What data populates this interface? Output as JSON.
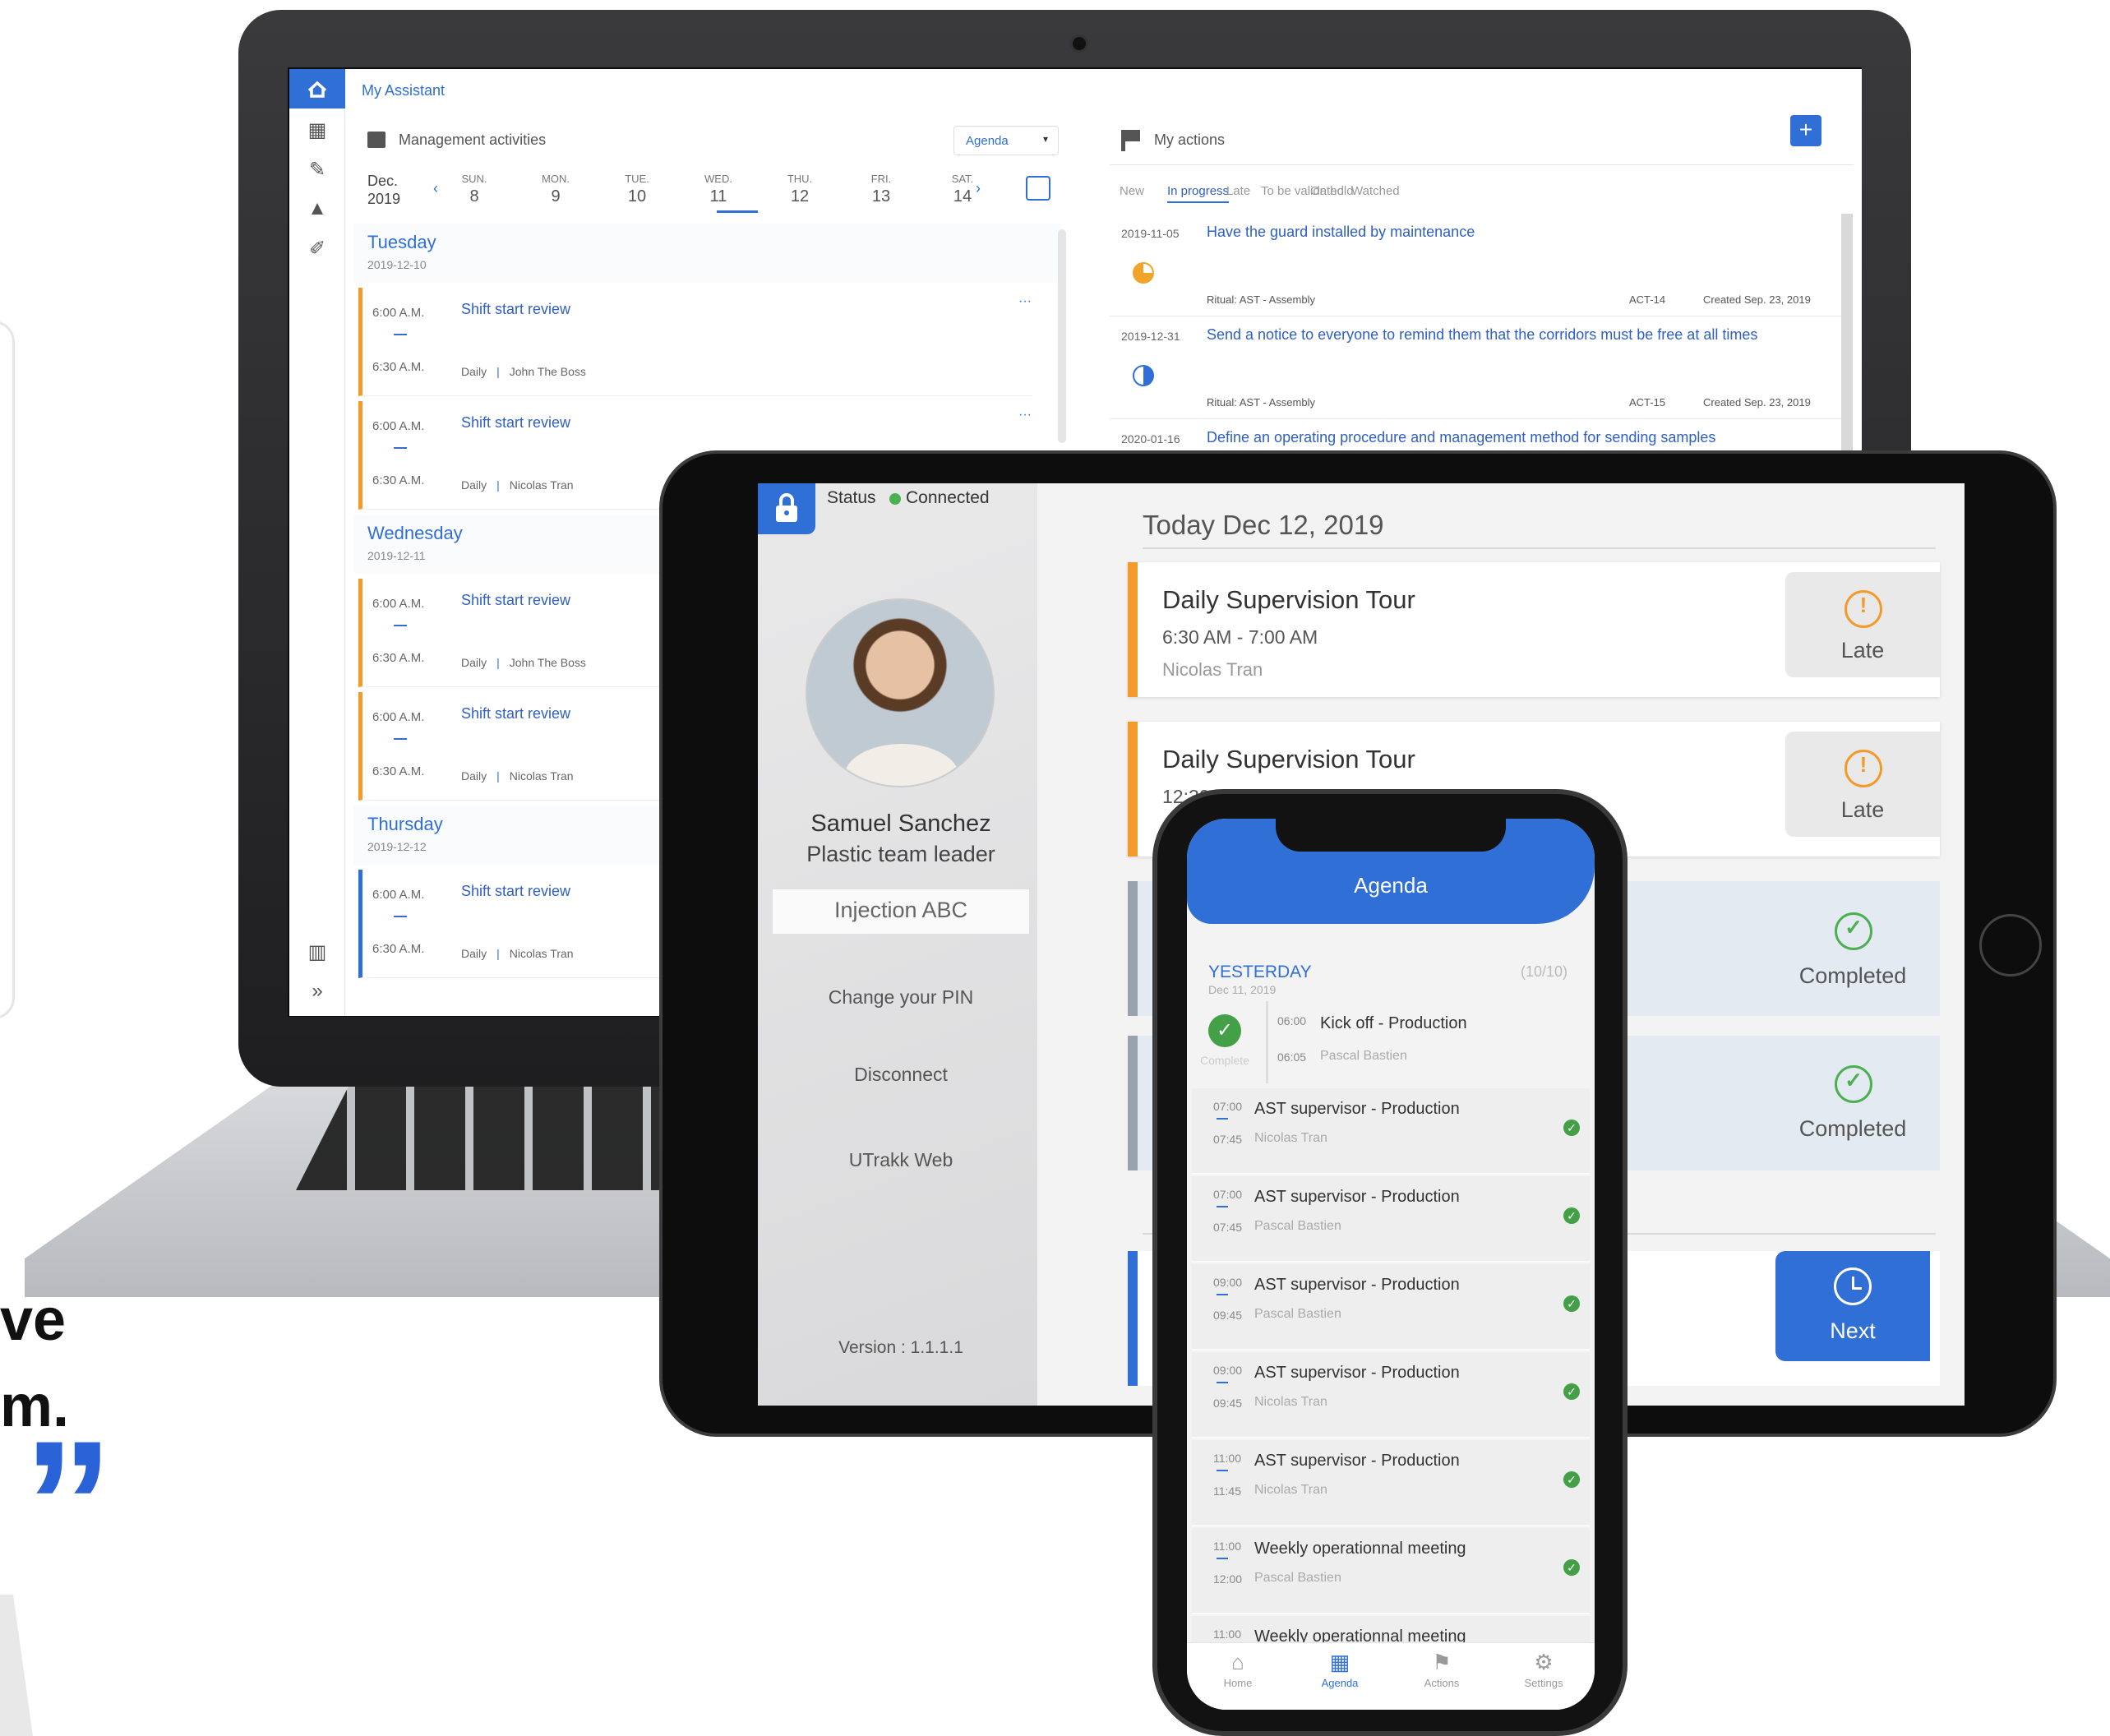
{
  "quote": {
    "line1": "ve",
    "line2": "m.",
    "mark": "”"
  },
  "desktop": {
    "app_title": "My Assistant",
    "management": {
      "title": "Management activities",
      "view_select": "Agenda",
      "month": "Dec.",
      "year": "2019",
      "days": [
        {
          "name": "SUN.",
          "num": "8"
        },
        {
          "name": "MON.",
          "num": "9"
        },
        {
          "name": "TUE.",
          "num": "10"
        },
        {
          "name": "WED.",
          "num": "11"
        },
        {
          "name": "THU.",
          "num": "12"
        },
        {
          "name": "FRI.",
          "num": "13"
        },
        {
          "name": "SAT.",
          "num": "14"
        }
      ],
      "sections": [
        {
          "day": "Tuesday",
          "date": "2019-12-10",
          "items": [
            {
              "start": "6:00 A.M.",
              "end": "6:30 A.M.",
              "title": "Shift start review",
              "freq": "Daily",
              "person": "John The Boss"
            },
            {
              "start": "6:00 A.M.",
              "end": "6:30 A.M.",
              "title": "Shift start review",
              "freq": "Daily",
              "person": "Nicolas Tran"
            }
          ]
        },
        {
          "day": "Wednesday",
          "date": "2019-12-11",
          "items": [
            {
              "start": "6:00 A.M.",
              "end": "6:30 A.M.",
              "title": "Shift start review",
              "freq": "Daily",
              "person": "John The Boss"
            },
            {
              "start": "6:00 A.M.",
              "end": "6:30 A.M.",
              "title": "Shift start review",
              "freq": "Daily",
              "person": "Nicolas Tran"
            }
          ]
        },
        {
          "day": "Thursday",
          "date": "2019-12-12",
          "items": [
            {
              "start": "6:00 A.M.",
              "end": "6:30 A.M.",
              "title": "Shift start review",
              "freq": "Daily",
              "person": "Nicolas Tran"
            }
          ]
        }
      ]
    },
    "actions": {
      "title": "My actions",
      "add": "+",
      "tabs": [
        "New",
        "In progress",
        "Late",
        "To be validated",
        "On hold",
        "Watched"
      ],
      "rows": [
        {
          "date": "2019-11-05",
          "title": "Have the guard installed by maintenance",
          "ritual": "Ritual: AST - Assembly",
          "ref": "ACT-14",
          "created": "Created Sep. 23, 2019"
        },
        {
          "date": "2019-12-31",
          "title": "Send a notice to everyone to remind them that the corridors must be free at all times",
          "ritual": "Ritual: AST - Assembly",
          "ref": "ACT-15",
          "created": "Created Sep. 23, 2019"
        },
        {
          "date": "2020-01-16",
          "title": "Define an operating procedure and management method for sending samples",
          "ritual": "",
          "ref": "",
          "created": ""
        }
      ]
    }
  },
  "tablet": {
    "status_label": "Status",
    "status_value": "Connected",
    "user_name": "Samuel Sanchez",
    "user_role": "Plastic team leader",
    "team": "Injection ABC",
    "menu": [
      "Change your PIN",
      "Disconnect",
      "UTrakk Web"
    ],
    "version": "Version : 1.1.1.1",
    "today": "Today Dec 12, 2019",
    "cards": [
      {
        "title": "Daily Supervision Tour",
        "time": "6:30 AM - 7:00 AM",
        "who": "Nicolas Tran",
        "status": "Late"
      },
      {
        "title": "Daily Supervision Tour",
        "time": "12:30 PM - 1:00 PM",
        "who": "",
        "status": "Late"
      },
      {
        "title": "",
        "time": "",
        "who": "",
        "status": "Completed"
      },
      {
        "title": "",
        "time": "",
        "who": "",
        "status": "Completed"
      },
      {
        "title": "",
        "time": "",
        "who": "",
        "status": "Next"
      }
    ]
  },
  "phone": {
    "title": "Agenda",
    "section": "YESTERDAY",
    "section_date": "Dec 11, 2019",
    "count": "(10/10)",
    "complete_label": "Complete",
    "rows": [
      {
        "start": "06:00",
        "end": "06:05",
        "title": "Kick off - Production",
        "who": "Pascal Bastien"
      },
      {
        "start": "07:00",
        "end": "07:45",
        "title": "AST supervisor - Production",
        "who": "Nicolas Tran"
      },
      {
        "start": "07:00",
        "end": "07:45",
        "title": "AST supervisor - Production",
        "who": "Pascal Bastien"
      },
      {
        "start": "09:00",
        "end": "09:45",
        "title": "AST supervisor - Production",
        "who": "Pascal Bastien"
      },
      {
        "start": "09:00",
        "end": "09:45",
        "title": "AST supervisor - Production",
        "who": "Nicolas Tran"
      },
      {
        "start": "11:00",
        "end": "11:45",
        "title": "AST supervisor - Production",
        "who": "Nicolas Tran"
      },
      {
        "start": "11:00",
        "end": "12:00",
        "title": "Weekly operationnal meeting",
        "who": "Pascal Bastien"
      },
      {
        "start": "11:00",
        "end": "",
        "title": "Weekly operationnal meeting",
        "who": ""
      }
    ],
    "nav": [
      "Home",
      "Agenda",
      "Actions",
      "Settings"
    ],
    "nav_active": "Agenda"
  },
  "colors": {
    "accent": "#2f6fd6",
    "late": "#f39a2b",
    "complete": "#4caf50"
  }
}
